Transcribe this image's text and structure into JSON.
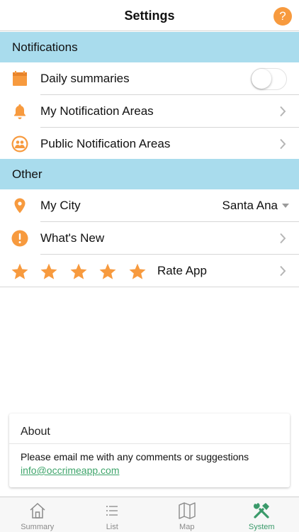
{
  "header": {
    "title": "Settings",
    "help_glyph": "?"
  },
  "sections": {
    "notifications": "Notifications",
    "other": "Other"
  },
  "rows": {
    "daily_summaries": "Daily summaries",
    "my_notification_areas": "My Notification Areas",
    "public_notification_areas": "Public Notification Areas",
    "my_city": "My City",
    "my_city_value": "Santa Ana",
    "whats_new": "What's New",
    "rate_app": "Rate App"
  },
  "toggles": {
    "daily_summaries_on": false
  },
  "rating_stars": 5,
  "about": {
    "title": "About",
    "text": "Please email me with any comments or suggestions",
    "email": "info@occrimeapp.com"
  },
  "tabs": [
    {
      "label": "Summary",
      "icon": "home-icon",
      "active": false
    },
    {
      "label": "List",
      "icon": "list-icon",
      "active": false
    },
    {
      "label": "Map",
      "icon": "map-icon",
      "active": false
    },
    {
      "label": "System",
      "icon": "tools-icon",
      "active": true
    }
  ],
  "colors": {
    "accent_orange": "#f79a3e",
    "section_header": "#a9dced",
    "active_tab": "#3a9a6a",
    "link_green": "#3fa56b"
  }
}
